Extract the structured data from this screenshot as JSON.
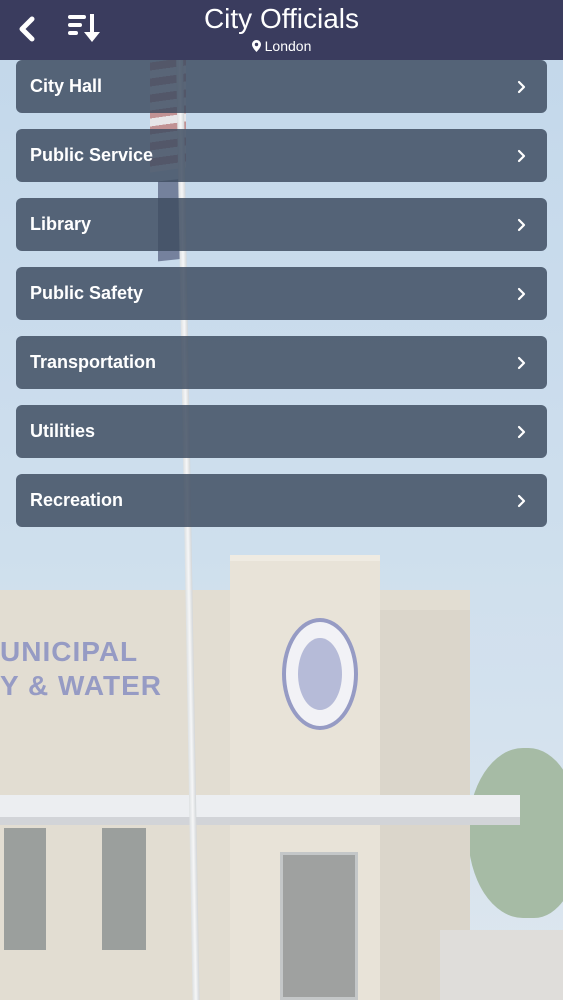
{
  "header": {
    "title": "City Officials",
    "location": "London",
    "back_icon": "chevron-left-icon",
    "sort_icon": "sort-descending-icon",
    "background_color": "#3a3c5e"
  },
  "menu": {
    "items": [
      {
        "label": "City Hall"
      },
      {
        "label": "Public Service"
      },
      {
        "label": "Library"
      },
      {
        "label": "Public Safety"
      },
      {
        "label": "Transportation"
      },
      {
        "label": "Utilities"
      },
      {
        "label": "Recreation"
      }
    ],
    "chevron_icon": "chevron-right-icon",
    "item_color": "#3e4c60"
  },
  "background": {
    "sign_text_line1": "UNICIPAL",
    "sign_text_line2": "Y & WATER"
  }
}
